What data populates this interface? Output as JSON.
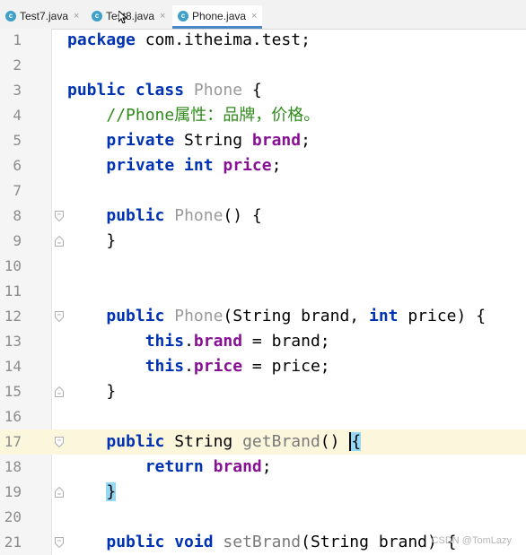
{
  "tabs": [
    {
      "label": "Test7.java",
      "icon": "class-icon"
    },
    {
      "label": "Test8.java",
      "icon": "class-icon"
    },
    {
      "label": "Phone.java",
      "icon": "class-icon",
      "active": true
    }
  ],
  "tab_close_glyph": "×",
  "tab_icon_letter": "c",
  "current_line": 17,
  "lines": [
    {
      "n": "1",
      "parts": [
        "package",
        " com.itheima.test;"
      ]
    },
    {
      "n": "2",
      "parts": []
    },
    {
      "n": "3",
      "parts": [
        "public class",
        " ",
        "Phone",
        " {"
      ]
    },
    {
      "n": "4",
      "parts": [
        "    ",
        "//Phone属性：品牌，价格。"
      ]
    },
    {
      "n": "5",
      "parts": [
        "    ",
        "private",
        " String ",
        "brand",
        ";"
      ]
    },
    {
      "n": "6",
      "parts": [
        "    ",
        "private int",
        " ",
        "price",
        ";"
      ]
    },
    {
      "n": "7",
      "parts": []
    },
    {
      "n": "8",
      "parts": [
        "    ",
        "public",
        " ",
        "Phone",
        "() {"
      ]
    },
    {
      "n": "9",
      "parts": [
        "    }"
      ]
    },
    {
      "n": "10",
      "parts": []
    },
    {
      "n": "11",
      "parts": []
    },
    {
      "n": "12",
      "parts": [
        "    ",
        "public",
        " ",
        "Phone",
        "(String brand, ",
        "int",
        " price) {"
      ]
    },
    {
      "n": "13",
      "parts": [
        "        ",
        "this",
        ".",
        "brand",
        " = brand;"
      ]
    },
    {
      "n": "14",
      "parts": [
        "        ",
        "this",
        ".",
        "price",
        " = price;"
      ]
    },
    {
      "n": "15",
      "parts": [
        "    }"
      ]
    },
    {
      "n": "16",
      "parts": []
    },
    {
      "n": "17",
      "parts": [
        "    ",
        "public",
        " String ",
        "getBrand",
        "() ",
        "{"
      ]
    },
    {
      "n": "18",
      "parts": [
        "        ",
        "return",
        " ",
        "brand",
        ";"
      ]
    },
    {
      "n": "19",
      "parts": [
        "    ",
        "}"
      ]
    },
    {
      "n": "20",
      "parts": []
    },
    {
      "n": "21",
      "parts": [
        "    ",
        "public void",
        " ",
        "setBrand",
        "(String brand) {"
      ]
    }
  ],
  "watermark": "CSDN @TomLazy",
  "colors": {
    "keyword": "#0033b3",
    "field": "#871094",
    "comment": "#2e8b1a",
    "class_name": "#9a9a9a",
    "current_line_bg": "#fcf6dc",
    "brace_highlight": "#93d9f5",
    "tab_accent": "#4a88c7"
  }
}
